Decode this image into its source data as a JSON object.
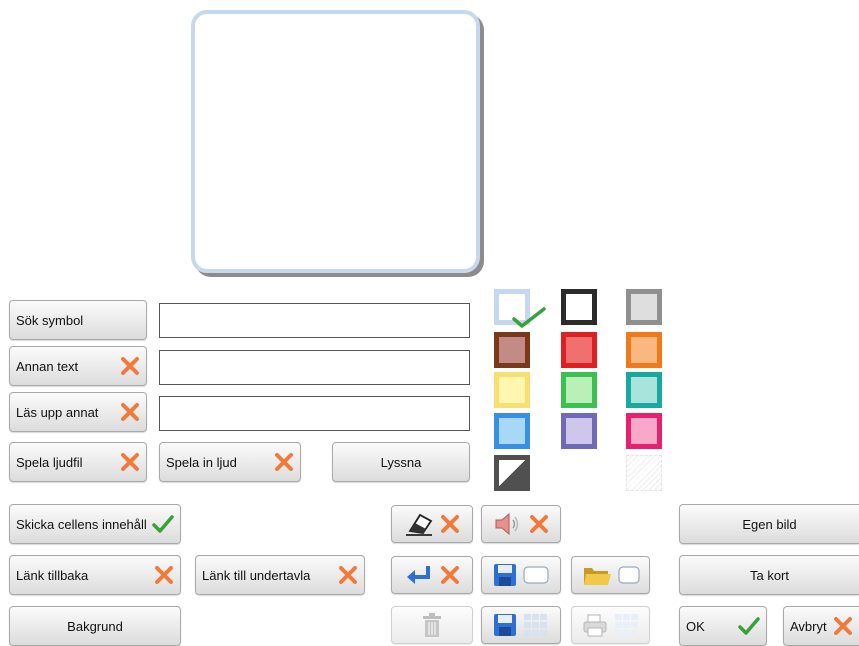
{
  "buttons": {
    "search_symbol": "Sök symbol",
    "other_text": "Annan text",
    "read_other": "Läs upp annat",
    "play_soundfile": "Spela ljudfil",
    "record_sound": "Spela in ljud",
    "listen": "Lyssna",
    "send_cell_content": "Skicka cellens innehåll",
    "link_back": "Länk tillbaka",
    "link_subboard": "Länk till undertavla",
    "background": "Bakgrund",
    "own_image": "Egen bild",
    "take_photo": "Ta kort",
    "ok": "OK",
    "cancel": "Avbryt"
  },
  "inputs": {
    "search_symbol_value": "",
    "other_text_value": "",
    "read_other_value": ""
  },
  "colors": {
    "accent_check": "#3aa03a",
    "x_mark": "#f07a3c",
    "swatches": [
      {
        "name": "none-selected",
        "border": "#c6d8ee",
        "fill": "#ffffff"
      },
      {
        "name": "black",
        "border": "#2b2b2b",
        "fill": "#ffffff"
      },
      {
        "name": "gray",
        "border": "#8f8f8f",
        "fill": "#dedede"
      },
      {
        "name": "brown",
        "border": "#7a3a1a",
        "fill": "#c48a86"
      },
      {
        "name": "red",
        "border": "#e02020",
        "fill": "#f07070"
      },
      {
        "name": "orange",
        "border": "#f07a1a",
        "fill": "#f8b880"
      },
      {
        "name": "yellow",
        "border": "#f8e070",
        "fill": "#fff6b0"
      },
      {
        "name": "green",
        "border": "#3cc050",
        "fill": "#b8f0b8"
      },
      {
        "name": "teal",
        "border": "#18a8a0",
        "fill": "#a8e4dc"
      },
      {
        "name": "blue",
        "border": "#3a90e0",
        "fill": "#a8d8f8"
      },
      {
        "name": "purple",
        "border": "#6e6ab8",
        "fill": "#cfc6ec"
      },
      {
        "name": "pink",
        "border": "#e82070",
        "fill": "#f8a8c8"
      },
      {
        "name": "invert",
        "border": "#505050",
        "fill": "#505050"
      },
      {
        "name": "transparent",
        "border": "#e4e4e4",
        "fill": "#ffffff"
      }
    ]
  },
  "icons": {
    "eraser": "eraser-icon",
    "speaker": "speaker-icon",
    "return": "return-arrow-icon",
    "save": "floppy-disk-icon",
    "folder": "folder-icon",
    "trash": "trash-icon",
    "print": "printer-icon"
  }
}
